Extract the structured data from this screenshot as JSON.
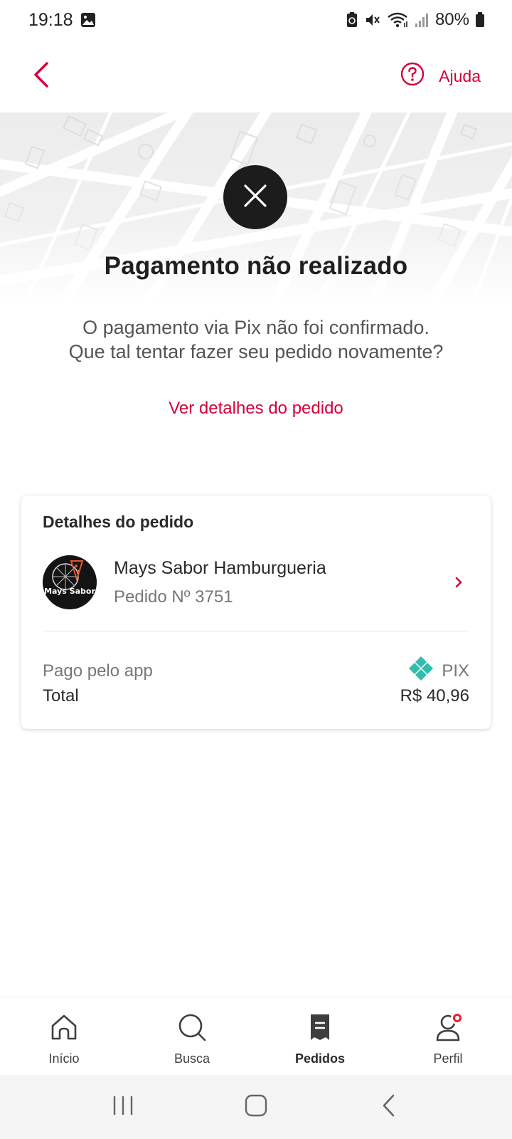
{
  "status_bar": {
    "time": "19:18",
    "battery": "80%"
  },
  "header": {
    "help_label": "Ajuda"
  },
  "main": {
    "title": "Pagamento não realizado",
    "subtitle_line1": "O pagamento via Pix não foi confirmado.",
    "subtitle_line2": "Que tal tentar fazer seu pedido novamente?",
    "details_link": "Ver detalhes do pedido"
  },
  "order_card": {
    "title": "Detalhes do pedido",
    "store_name": "Mays Sabor Hamburgueria",
    "order_number": "Pedido Nº 3751",
    "logo_text": "Mays Sabor",
    "paid_label": "Pago pelo app",
    "payment_method": "PIX",
    "total_label": "Total",
    "total_value": "R$ 40,96"
  },
  "bottom_nav": {
    "items": [
      {
        "label": "Início",
        "icon": "home-icon"
      },
      {
        "label": "Busca",
        "icon": "search-icon"
      },
      {
        "label": "Pedidos",
        "icon": "orders-icon",
        "active": true
      },
      {
        "label": "Perfil",
        "icon": "profile-icon",
        "notification": true
      }
    ]
  },
  "colors": {
    "accent": "#d4003a",
    "error_circle": "#1c1c1c",
    "pix": "#32bcad",
    "notification": "#ea1d2c"
  }
}
